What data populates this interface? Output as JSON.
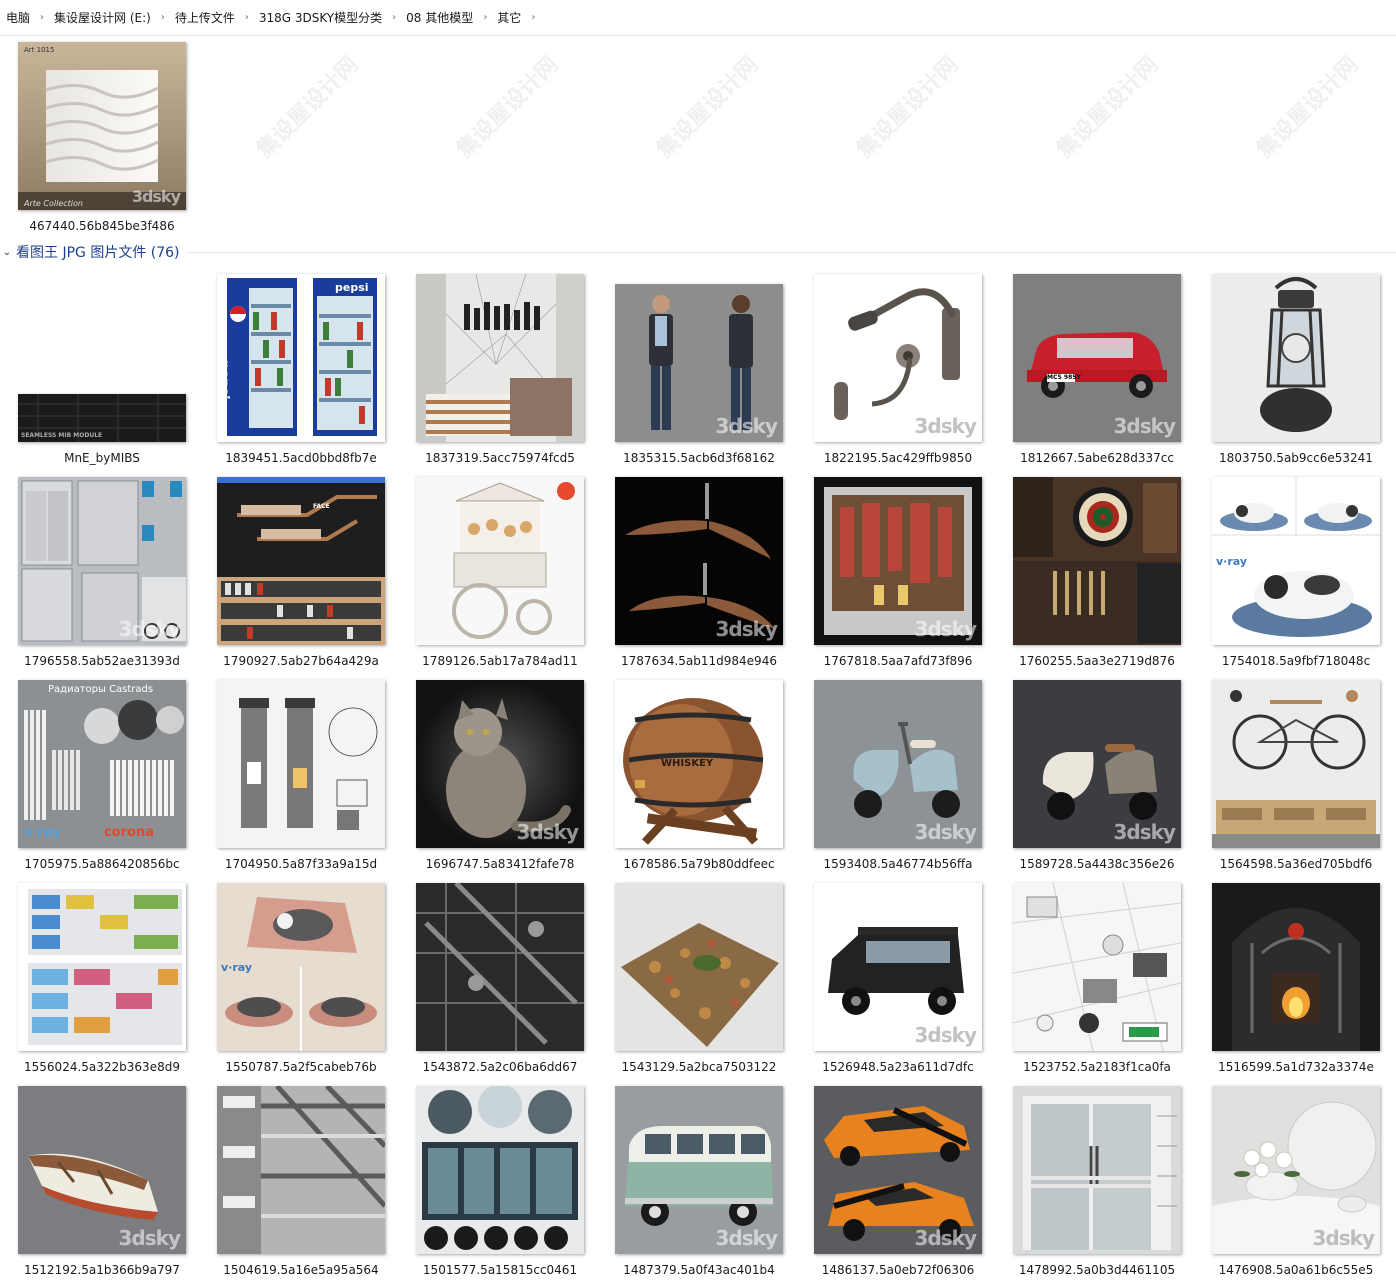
{
  "breadcrumb": [
    {
      "label": "电脑"
    },
    {
      "label": "集设屋设计网 (E:)"
    },
    {
      "label": "待上传文件"
    },
    {
      "label": "318G 3DSKY模型分类"
    },
    {
      "label": "08 其他模型"
    },
    {
      "label": "其它"
    }
  ],
  "group": {
    "title": "看图王 JPG 图片文件 (76)"
  },
  "watermarks": {
    "brand": "3dsky",
    "site_cn": "集设屋设计网",
    "site_en": "JISHEWU.COM"
  },
  "top_file": {
    "name": "467440.56b845be3f486",
    "label_small": "Art 1015",
    "label_sig": "Arte Collection"
  },
  "thumb_texts": {
    "pepsi": "pepsi",
    "mib_text": "SEAMLESS MIB MODULE",
    "radiator_title": "Радиаторы Castrads",
    "vray": "v·ray",
    "corona": "corona",
    "whiskey": "WHISKEY",
    "mcs": "MCS 985Y",
    "face": "FACE"
  },
  "files": [
    {
      "name": "MnE_byMIBS"
    },
    {
      "name": "1839451.5acd0bbd8fb7e"
    },
    {
      "name": "1837319.5acc75974fcd5"
    },
    {
      "name": "1835315.5acb6d3f68162"
    },
    {
      "name": "1822195.5ac429ffb9850"
    },
    {
      "name": "1812667.5abe628d337cc"
    },
    {
      "name": "1803750.5ab9cc6e53241"
    },
    {
      "name": "1796558.5ab52ae31393d"
    },
    {
      "name": "1790927.5ab27b64a429a"
    },
    {
      "name": "1789126.5ab17a784ad11"
    },
    {
      "name": "1787634.5ab11d984e946"
    },
    {
      "name": "1767818.5aa7afd73f896"
    },
    {
      "name": "1760255.5aa3e2719d876"
    },
    {
      "name": "1754018.5a9fbf718048c"
    },
    {
      "name": "1705975.5a886420856bc"
    },
    {
      "name": "1704950.5a87f33a9a15d"
    },
    {
      "name": "1696747.5a83412fafe78"
    },
    {
      "name": "1678586.5a79b80ddfeec"
    },
    {
      "name": "1593408.5a46774b56ffa"
    },
    {
      "name": "1589728.5a4438c356e26"
    },
    {
      "name": "1564598.5a36ed705bdf6"
    },
    {
      "name": "1556024.5a322b363e8d9"
    },
    {
      "name": "1550787.5a2f5cabeb76b"
    },
    {
      "name": "1543872.5a2c06ba6dd67"
    },
    {
      "name": "1543129.5a2bca7503122"
    },
    {
      "name": "1526948.5a23a611d7dfc"
    },
    {
      "name": "1523752.5a2183f1ca0fa"
    },
    {
      "name": "1516599.5a1d732a3374e"
    },
    {
      "name": "1512192.5a1b366b9a797"
    },
    {
      "name": "1504619.5a16e5a95a564"
    },
    {
      "name": "1501577.5a15815cc0461"
    },
    {
      "name": "1487379.5a0f43ac401b4"
    },
    {
      "name": "1486137.5a0eb72f06306"
    },
    {
      "name": "1478992.5a0b3d4461105"
    },
    {
      "name": "1476908.5a0a61b6c55e5"
    }
  ]
}
